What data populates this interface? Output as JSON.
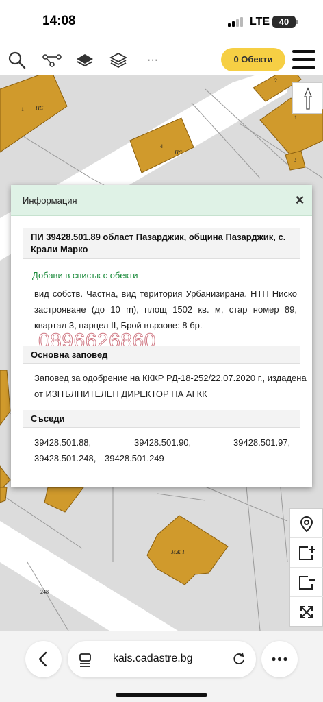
{
  "status_bar": {
    "time": "14:08",
    "network": "LTE",
    "battery": "40"
  },
  "toolbar": {
    "objects_button": "0 Обекти",
    "more_label": "···"
  },
  "map": {
    "labels": {
      "parcel_1_left": "1",
      "ps_left": "ПС",
      "parcel_4": "4",
      "ps_center": "ПС",
      "parcel_2_right": "2",
      "parcel_1_right": "1",
      "parcel_3_right": "3",
      "mzh_building": "МЖ 1",
      "number_248": "248"
    }
  },
  "dialog": {
    "title": "Информация",
    "close": "×",
    "parcel_title": "ПИ 39428.501.89 област Пазарджик, община Пазарджик, с. Крали Марко",
    "add_link": "Добави в списък с обекти",
    "description": "вид собств. Частна, вид територия Урбанизирана, НТП Ниско застрояване (до 10 m), площ 1502 кв. м, стар номер 89, квартал 3, парцел II, Брой вързове: 8 бр.",
    "watermark_phone": "0896626860",
    "order_heading": "Основна заповед",
    "order_text": "Заповед за одобрение на КККР РД-18-252/22.07.2020 г., издадена от ИЗПЪЛНИТЕЛЕН ДИРЕКТОР НА АГКК",
    "neighbors_heading": "Съседи",
    "neighbors": [
      "39428.501.88,",
      "39428.501.90,",
      "39428.501.97,",
      "39428.501.248,",
      "39428.501.249"
    ]
  },
  "browser": {
    "url": "kais.cadastre.bg"
  }
}
